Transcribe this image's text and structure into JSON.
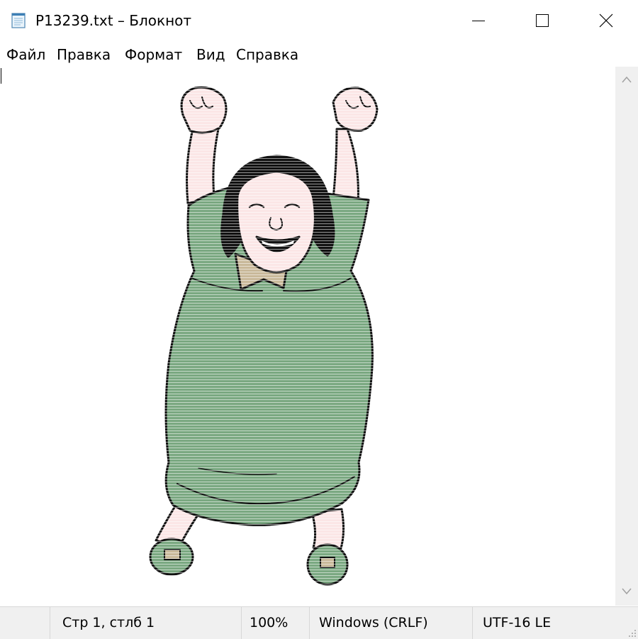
{
  "window": {
    "title": "P13239.txt – Блокнот",
    "icon": "notepad-icon",
    "controls": [
      "minimize-icon",
      "maximize-icon",
      "close-icon"
    ]
  },
  "menu": {
    "items": [
      "Файл",
      "Правка",
      "Формат",
      "Вид",
      "Справка"
    ]
  },
  "editor": {
    "content_description_icon": "ascii-art-cheering-woman"
  },
  "statusbar": {
    "position": "Стр 1, стлб 1",
    "zoom": "100%",
    "line_endings": "Windows (CRLF)",
    "encoding": "UTF-16 LE"
  },
  "colors": {
    "dress": "#7aa881",
    "skin": "#fbe6e6",
    "hair": "#111111",
    "collar": "#c9b99a"
  }
}
